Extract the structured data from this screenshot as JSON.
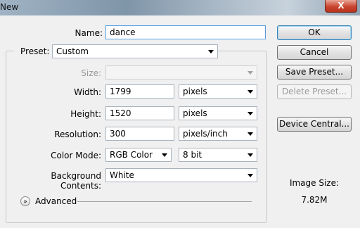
{
  "window": {
    "title": "New",
    "close_label": "X"
  },
  "form": {
    "name_label": "Name:",
    "name_value": "dance",
    "preset_label": "Preset:",
    "preset_value": "Custom",
    "size_label": "Size:",
    "size_value": "",
    "width_label": "Width:",
    "width_value": "1799",
    "width_unit": "pixels",
    "height_label": "Height:",
    "height_value": "1520",
    "height_unit": "pixels",
    "resolution_label": "Resolution:",
    "resolution_value": "300",
    "resolution_unit": "pixels/inch",
    "color_mode_label": "Color Mode:",
    "color_mode_value": "RGB Color",
    "bit_depth_value": "8 bit",
    "background_label": "Background Contents:",
    "background_value": "White",
    "advanced_label": "Advanced"
  },
  "buttons": {
    "ok": "OK",
    "cancel": "Cancel",
    "save_preset": "Save Preset...",
    "delete_preset": "Delete Preset...",
    "device_central": "Device Central..."
  },
  "info": {
    "image_size_label": "Image Size:",
    "image_size_value": "7.82M"
  }
}
